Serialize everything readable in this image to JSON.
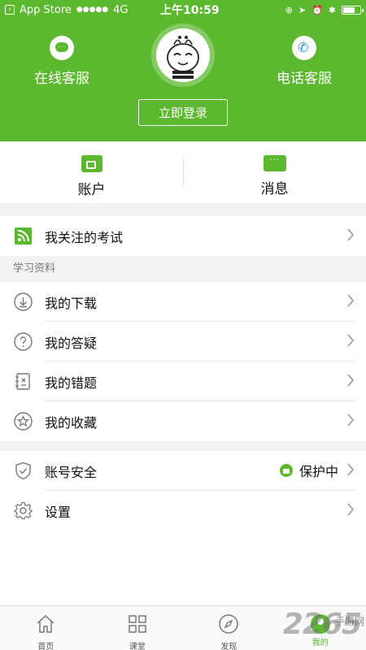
{
  "status_bar": {
    "carrier_app": "App Store",
    "signal": "●●●●●",
    "network": "4G",
    "time": "上午10:59",
    "right_icons": [
      "lock-rotation-icon",
      "location-icon",
      "alarm-icon",
      "bluetooth-icon"
    ]
  },
  "header": {
    "online_service_label": "在线客服",
    "phone_service_label": "电话客服",
    "login_button": "立即登录"
  },
  "quick": {
    "account_label": "账户",
    "messages_label": "消息"
  },
  "list": {
    "followed_exams": "我关注的考试",
    "section_title": "学习资料",
    "downloads": "我的下载",
    "answers": "我的答疑",
    "mistakes": "我的错题",
    "favorites": "我的收藏",
    "account_security": "账号安全",
    "security_status": "保护中",
    "settings": "设置"
  },
  "tabs": [
    {
      "label": "首页",
      "icon": "home-icon",
      "active": false
    },
    {
      "label": "课堂",
      "icon": "grid-icon",
      "active": false
    },
    {
      "label": "发现",
      "icon": "compass-icon",
      "active": false
    },
    {
      "label": "我的",
      "icon": "profile-icon",
      "active": true
    }
  ],
  "watermark": {
    "number": "2265",
    "text": "手游网"
  },
  "colors": {
    "accent": "#5cb82f",
    "background": "#f2f2f2"
  }
}
